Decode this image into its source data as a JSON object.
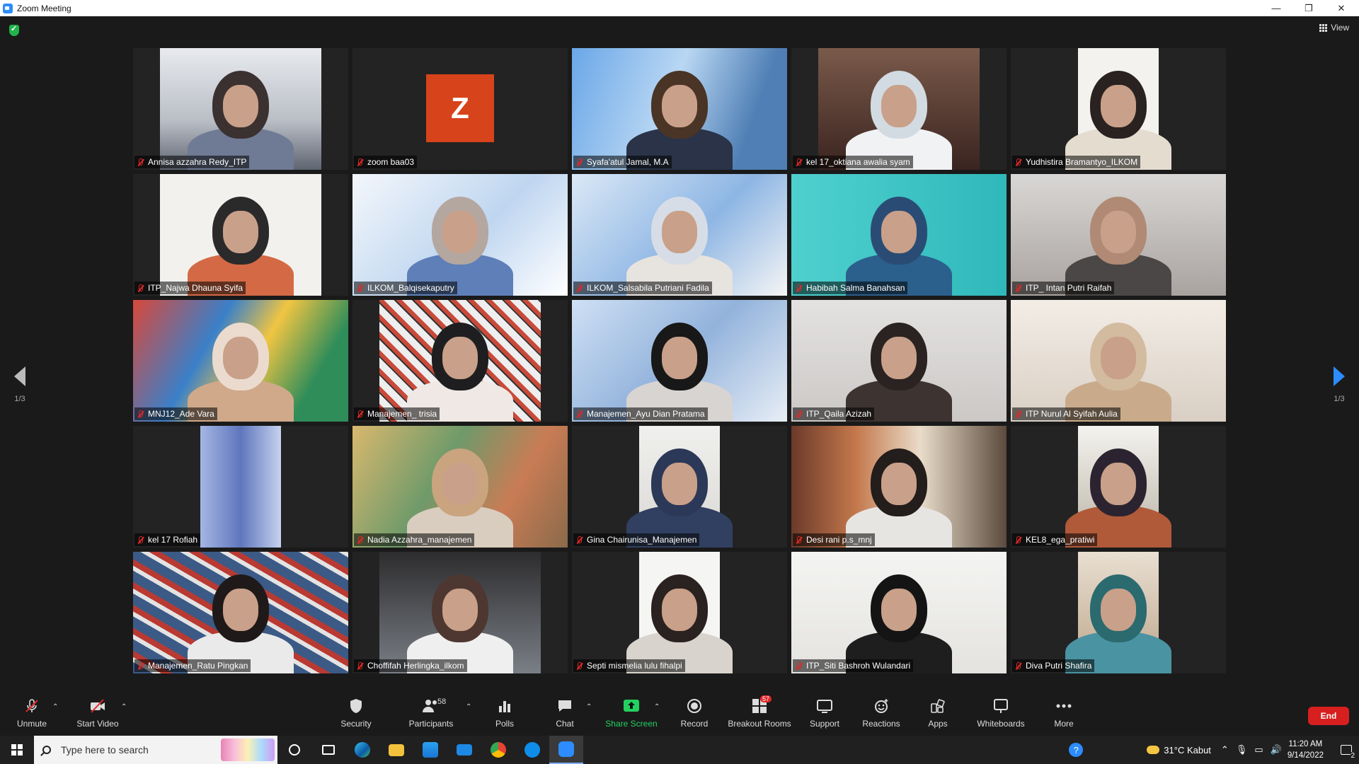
{
  "window": {
    "title": "Zoom Meeting",
    "minimize": "—",
    "restore": "❐",
    "close": "✕"
  },
  "view_label": "View",
  "page_indicator": {
    "left": "1/3",
    "right": "1/3"
  },
  "participants": [
    {
      "name": "Annisa azzahra Redy_ITP",
      "style": "ceiling"
    },
    {
      "name": "zoom baa03",
      "avatar_letter": "Z",
      "style": "avatar"
    },
    {
      "name": "Syafa'atul Jamal, M.A",
      "style": "man-sky",
      "active_speaker": true
    },
    {
      "name": "kel 17_oktiana awalia syam",
      "style": "hijab-office"
    },
    {
      "name": "Yudhistira Bramantyo_ILKOM",
      "style": "man-white"
    },
    {
      "name": "ITP_Najwa Dhauna Syifa",
      "style": "hijab-white"
    },
    {
      "name": "ILKOM_Balqisekaputry",
      "style": "hijab-banner"
    },
    {
      "name": "ILKOM_Salsabila Putriani Fadila",
      "style": "hijab-banner2"
    },
    {
      "name": "Habibah Salma Banahsan",
      "style": "hijab-teal"
    },
    {
      "name": "ITP_ Intan Putri Raifah",
      "style": "hijab-grey"
    },
    {
      "name": "MNJ12_Ade Vara",
      "style": "mural"
    },
    {
      "name": "Manajemen_ trisia",
      "style": "comic"
    },
    {
      "name": "Manajemen_Ayu Dian Pratama",
      "style": "hijab-banner3"
    },
    {
      "name": "ITP_Qaila Azizah",
      "style": "grey-dark"
    },
    {
      "name": "ITP Nurul Al Syifah Aulia",
      "style": "hijab-beige"
    },
    {
      "name": "kel 17 Rofiah",
      "style": "tower"
    },
    {
      "name": "Nadia Azzahra_manajemen",
      "style": "blur-warm"
    },
    {
      "name": "Gina Chairunisa_Manajemen",
      "style": "ceiling-fan"
    },
    {
      "name": "Desi rani p.s_mnj",
      "style": "cafe"
    },
    {
      "name": "KEL8_ega_pratiwi",
      "style": "plant-room"
    },
    {
      "name": "Manajemen_Ratu Pingkan",
      "style": "mural2"
    },
    {
      "name": "Choffifah Herlingka_ilkom",
      "style": "hijab-dark"
    },
    {
      "name": "Septi mismelia lulu fihalpi",
      "style": "white-mask"
    },
    {
      "name": "ITP_Siti Bashroh Wulandari",
      "style": "white-top"
    },
    {
      "name": "Diva Putri Shafira",
      "style": "batik"
    }
  ],
  "toolbar": {
    "unmute": "Unmute",
    "start_video": "Start Video",
    "security": "Security",
    "participants": "Participants",
    "participant_count": "58",
    "polls": "Polls",
    "chat": "Chat",
    "share_screen": "Share Screen",
    "record": "Record",
    "breakout_rooms": "Breakout Rooms",
    "breakout_badge": "57",
    "support": "Support",
    "reactions": "Reactions",
    "apps": "Apps",
    "whiteboards": "Whiteboards",
    "more": "More",
    "end": "End"
  },
  "taskbar": {
    "search_placeholder": "Type here to search",
    "weather": "31°C  Kabut",
    "time": "11:20 AM",
    "date": "9/14/2022",
    "notification_count": "2"
  },
  "colors": {
    "accent": "#2d8cff",
    "active_speaker": "#d6e84a",
    "end": "#d81f1f",
    "share": "#23d160"
  }
}
